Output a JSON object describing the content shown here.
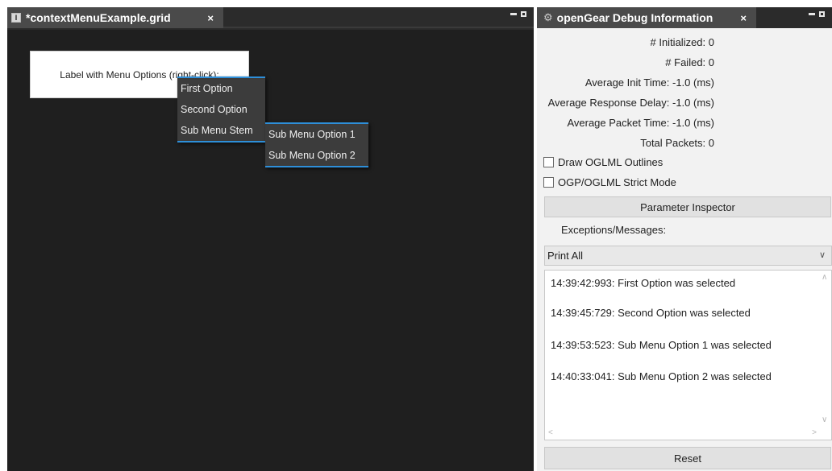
{
  "editor": {
    "tab_title": "*contextMenuExample.grid",
    "tab_close": "×",
    "grid_icon": "⧗",
    "label_text": "Label with Menu Options (right-click):",
    "context_menu": [
      "First Option",
      "Second Option",
      "Sub Menu Stem"
    ],
    "submenu": [
      "Sub Menu Option 1",
      "Sub Menu Option 2"
    ]
  },
  "debug": {
    "tab_title": "openGear Debug Information",
    "tab_close": "×",
    "tab_icon": "gear-icon",
    "stats": [
      "# Initialized: 0",
      "# Failed: 0",
      "Average Init Time: -1.0 (ms)",
      "Average Response Delay: -1.0 (ms)",
      "Average Packet Time: -1.0 (ms)",
      "Total Packets: 0"
    ],
    "checkboxes": [
      {
        "label": "Draw OGLML Outlines",
        "checked": false
      },
      {
        "label": "OGP/OGLML Strict Mode",
        "checked": false
      }
    ],
    "param_button": "Parameter Inspector",
    "exceptions_label": "Exceptions/Messages:",
    "print_select": "Print All",
    "messages": [
      "14:39:42:993: First Option was selected",
      "14:39:45:729: Second Option was selected",
      "14:39:53:523: Sub Menu Option 1 was selected",
      "14:40:33:041: Sub Menu Option 2 was selected"
    ],
    "reset_button": "Reset"
  },
  "colors": {
    "editor_bg": "#1f1f1f",
    "tab_bg": "#4a4a4a",
    "menu_bg": "#3c3c3c",
    "menu_accent": "#2e8fd9",
    "panel_bg": "#f2f2f2"
  }
}
